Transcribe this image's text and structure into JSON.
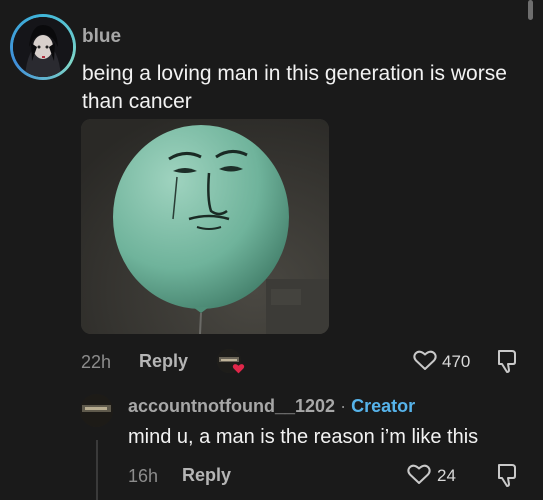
{
  "comment": {
    "author": "blue",
    "text": "being a loving man in this generation is worse than cancer",
    "time": "22h",
    "reply_label": "Reply",
    "like_count": "470"
  },
  "reply": {
    "author": "accountnotfound__1202",
    "separator": "·",
    "badge": "Creator",
    "text": "mind u, a man is the reason i’m like this",
    "time": "16h",
    "reply_label": "Reply",
    "like_count": "24"
  },
  "colors": {
    "background": "#1a1a1a",
    "creator_badge": "#56b3ea",
    "liked_heart": "#e0274a"
  }
}
